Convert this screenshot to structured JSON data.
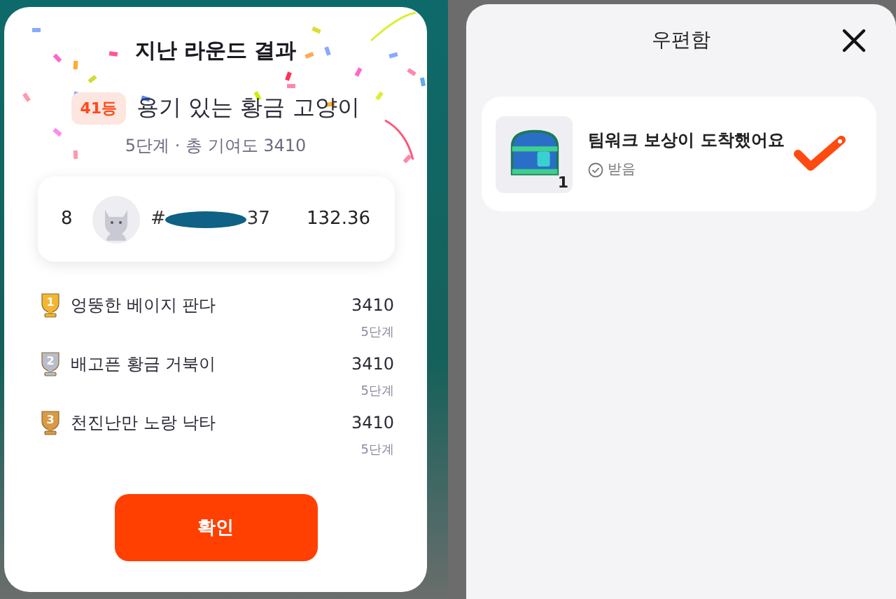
{
  "result_dialog": {
    "title": "지난 라운드 결과",
    "rank_badge": "41등",
    "team_name": "용기 있는 황금 고양이",
    "subtitle": "5단계 · 총 기여도 3410",
    "my_entry": {
      "rank": "8",
      "name_prefix": "#",
      "name_suffix": "37",
      "score": "132.36"
    },
    "leaderboard": [
      {
        "place": "1",
        "color": "#f2b632",
        "name": "엉뚱한 베이지 판다",
        "score": "3410",
        "stage": "5단계"
      },
      {
        "place": "2",
        "color": "#b9bccb",
        "name": "배고픈 황금 거북이",
        "score": "3410",
        "stage": "5단계"
      },
      {
        "place": "3",
        "color": "#d99a45",
        "name": "천진난만 노랑 낙타",
        "score": "3410",
        "stage": "5단계"
      }
    ],
    "confirm_button": "확인"
  },
  "mailbox": {
    "title": "우편함",
    "items": [
      {
        "title": "팀워크 보상이 도착했어요",
        "status": "받음",
        "count": "1",
        "received": true
      }
    ]
  }
}
